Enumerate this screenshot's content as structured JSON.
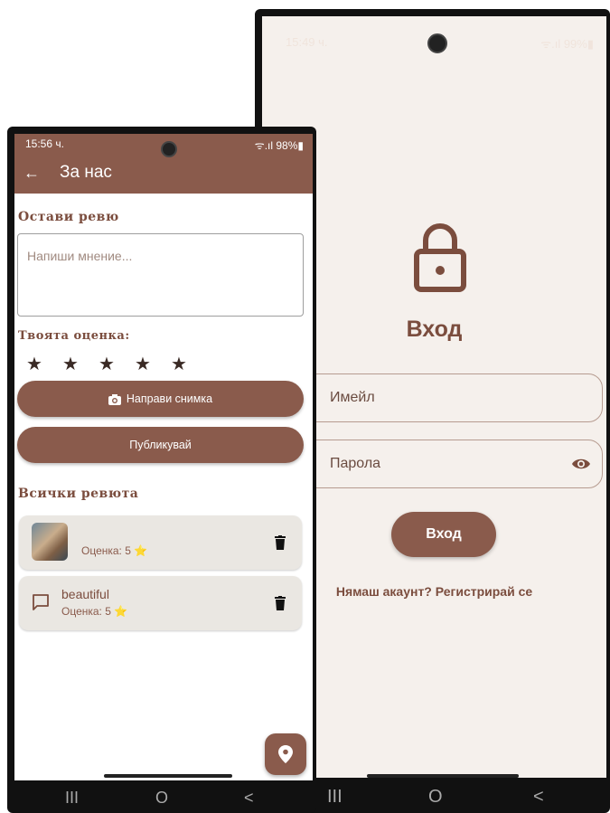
{
  "login_screen": {
    "status_time": "15:49 ч.",
    "status_right": "ᯤ.ıl 99%▮",
    "title": "Вход",
    "email_label": "Имейл",
    "password_label": "Парола",
    "login_button": "Вход",
    "register_link": "Нямаш акаунт? Регистрирай се",
    "icons": [
      "lock-icon",
      "eye-icon"
    ]
  },
  "about_screen": {
    "status_time": "15:56 ч.",
    "status_right": "ᯤ.ıl 98%▮",
    "back_label": "←",
    "title": "За нас",
    "leave_review_heading": "Остави ревю",
    "review_placeholder": "Напиши мнение...",
    "rating_heading": "Твоята оценка:",
    "stars": [
      "★",
      "★",
      "★",
      "★",
      "★"
    ],
    "photo_button": "Направи снимка",
    "publish_button": "Публикувай",
    "all_reviews_heading": "Всички ревюта",
    "reviews": [
      {
        "text": "",
        "rating_label": "Оценка: 5 ⭐",
        "has_photo": true
      },
      {
        "text": "beautiful",
        "rating_label": "Оценка: 5 ⭐",
        "has_photo": false
      }
    ]
  },
  "nav_bar": {
    "recent": "III",
    "home": "O",
    "back": "<"
  },
  "colors": {
    "primary": "#8a5b4c",
    "text_brown": "#7b4d3e",
    "login_bg": "#f5f0ec",
    "card_bg": "#eae7e2"
  }
}
